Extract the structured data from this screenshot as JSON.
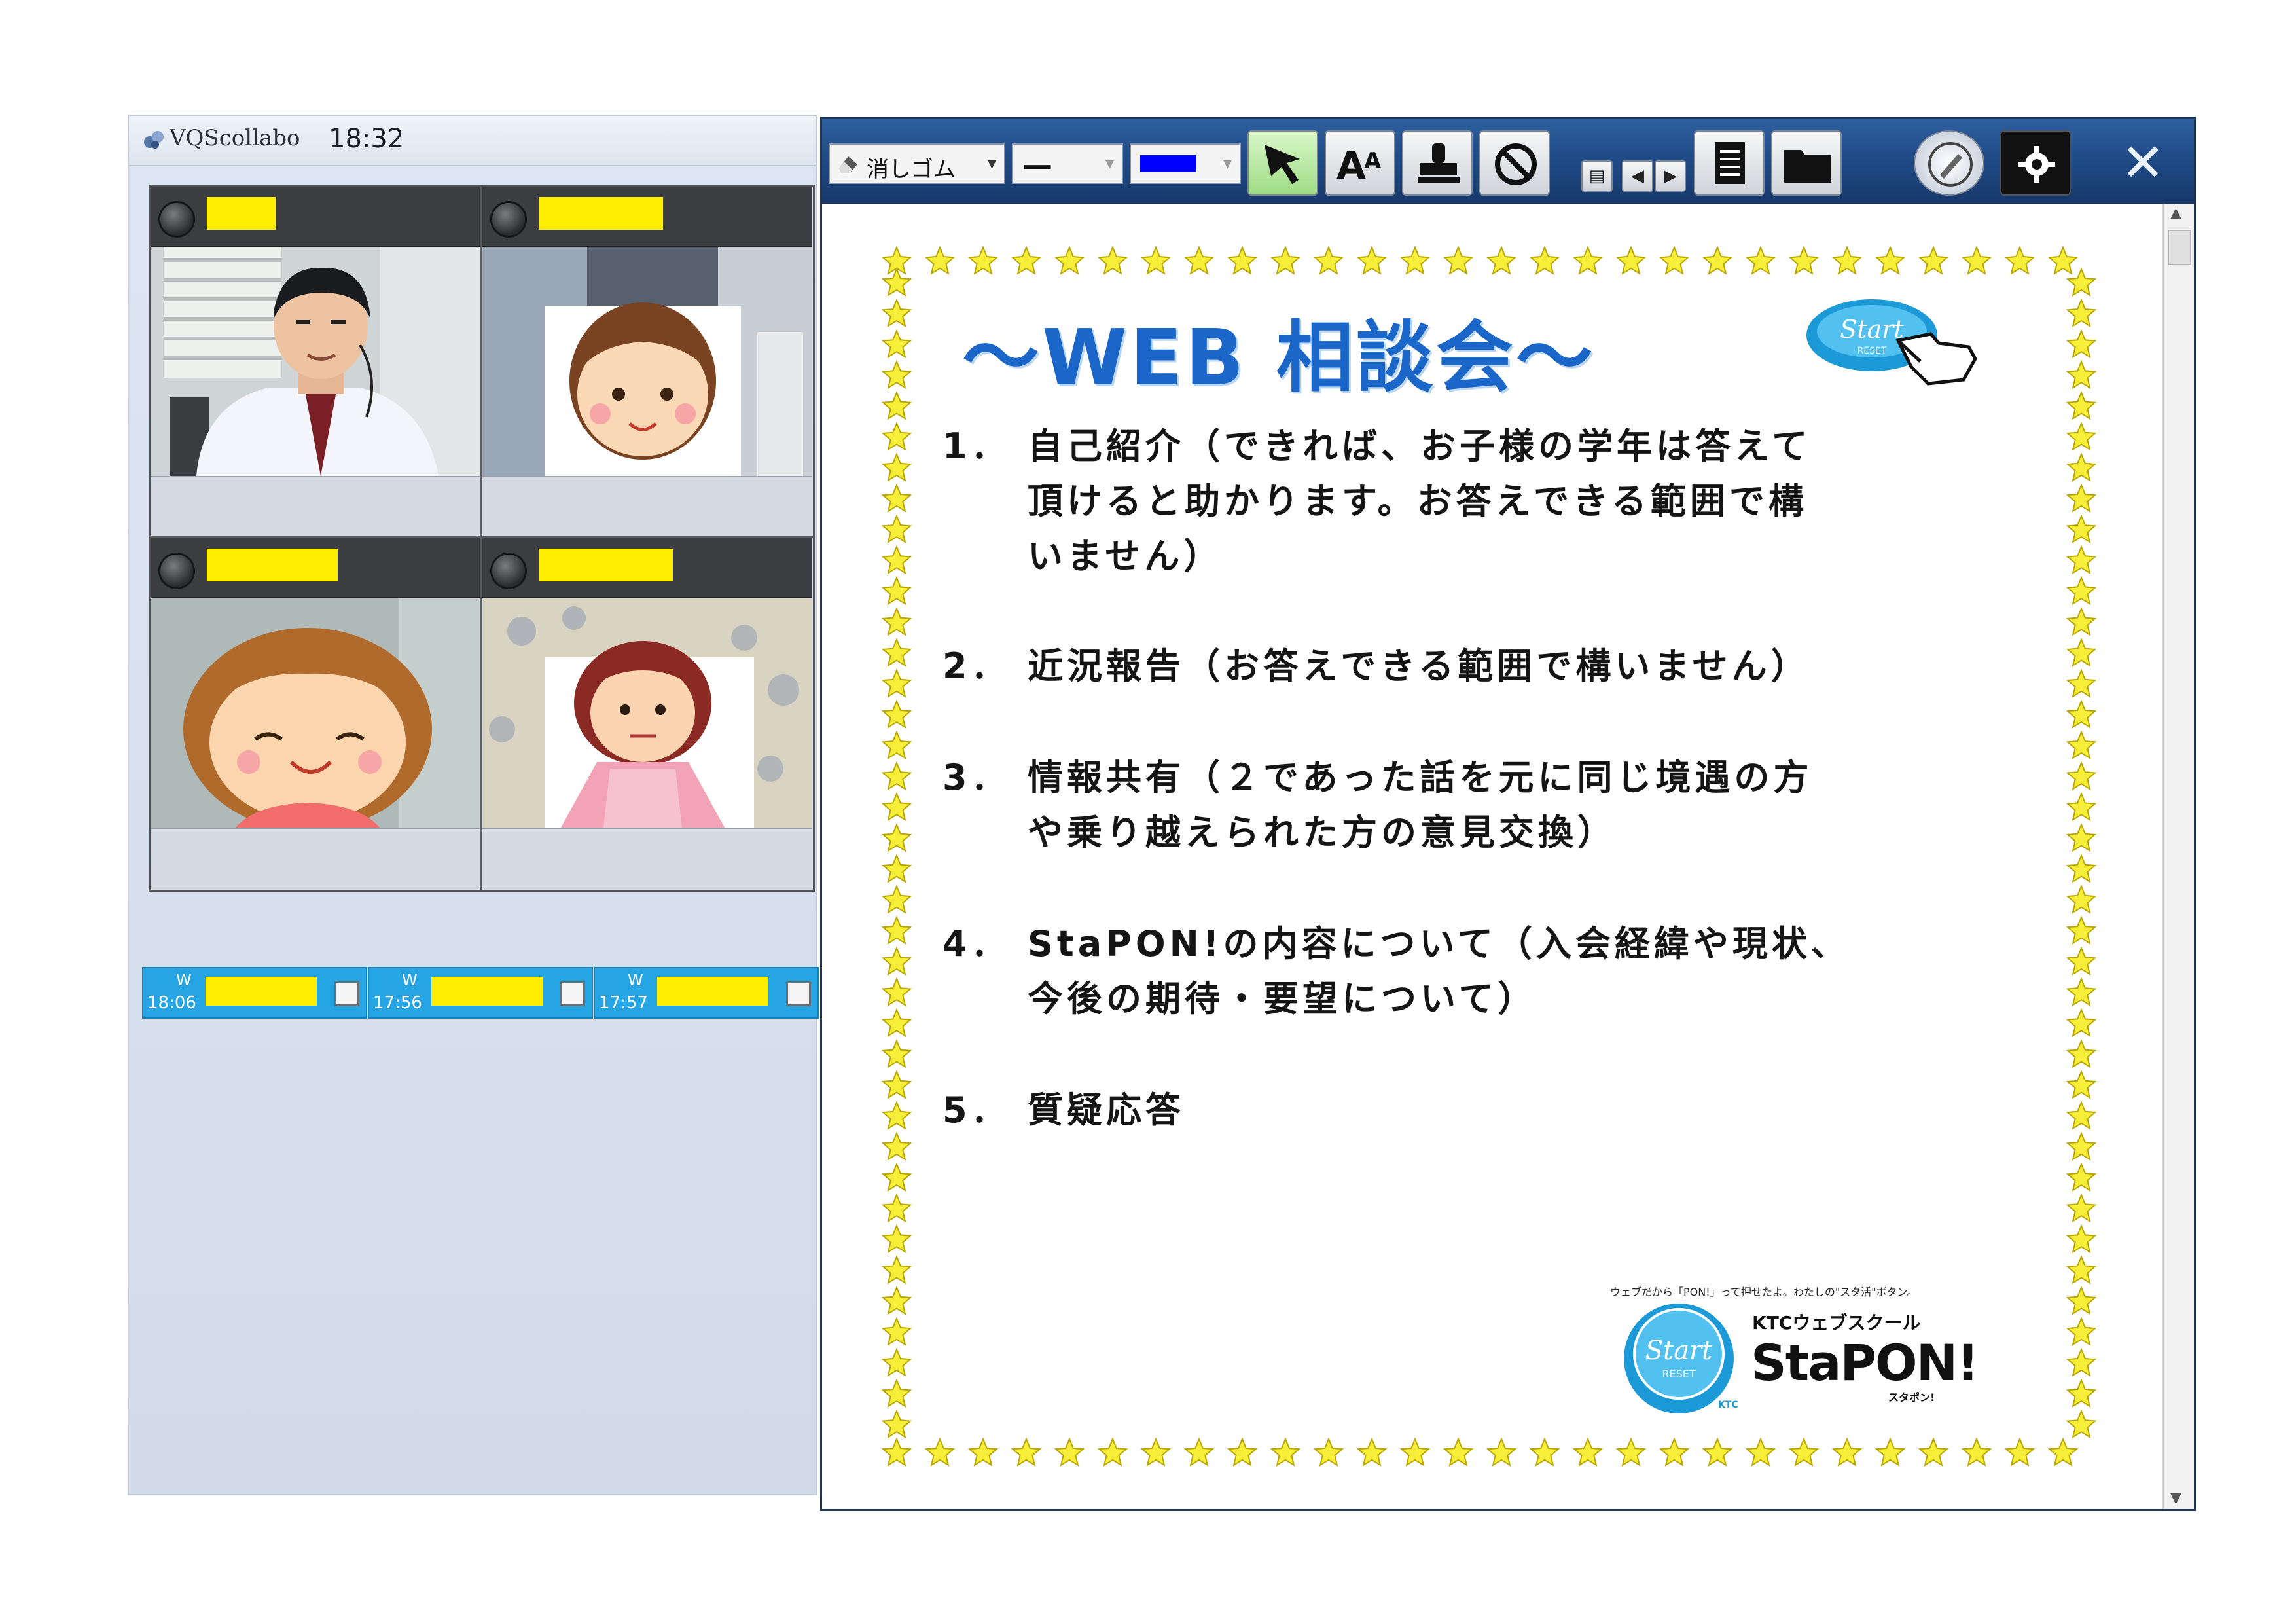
{
  "left_app": {
    "name": "VQScollabo",
    "time": "18:32",
    "participants": [
      {
        "id": "p1"
      },
      {
        "id": "p2"
      },
      {
        "id": "p3"
      },
      {
        "id": "p4"
      }
    ],
    "waiting": [
      {
        "label": "W",
        "time": "18:06"
      },
      {
        "label": "W",
        "time": "17:56"
      },
      {
        "label": "W",
        "time": "17:57"
      }
    ]
  },
  "toolbar": {
    "eraser_select": "消しゴム",
    "line_select": "—",
    "tools": [
      "pointer-icon",
      "text-size-icon",
      "stamp-icon",
      "prohibit-icon",
      "page-icon",
      "folder-icon",
      "pen-circle-icon",
      "gear-icon"
    ],
    "page_prev": "◀",
    "page_next": "▶",
    "close": "✕",
    "colors": {
      "accent": "#1e4a85",
      "pen_color": "#0000ff",
      "highlight": "#ffee00"
    }
  },
  "document": {
    "title": "〜WEB 相談会〜",
    "items": [
      {
        "num": "1．",
        "lines": [
          "自己紹介（できれば、お子様の学年は答えて",
          "頂けると助かります。お答えできる範囲で構",
          "いません）"
        ]
      },
      {
        "num": "2．",
        "lines": [
          "近況報告（お答えできる範囲で構いません）"
        ]
      },
      {
        "num": "3．",
        "lines": [
          "情報共有（２であった話を元に同じ境遇の方",
          "や乗り越えられた方の意見交換）"
        ]
      },
      {
        "num": "4．",
        "lines": [
          "StaPON!の内容について（入会経緯や現状、",
          "今後の期待・要望について）"
        ]
      },
      {
        "num": "5．",
        "lines": [
          "質疑応答"
        ]
      }
    ],
    "footer_tagline": "ウェブだから「PON!」って押せたよ。わたしの\"スタ活\"ボタン。",
    "logo": {
      "button_text": "Start",
      "button_sub": "RESET",
      "maker": "KTC",
      "school": "KTCウェブスクール",
      "brand": "StaPON!",
      "brand_kana": "スタポン!"
    },
    "badge_text": "Start",
    "badge_sub": "RESET"
  }
}
